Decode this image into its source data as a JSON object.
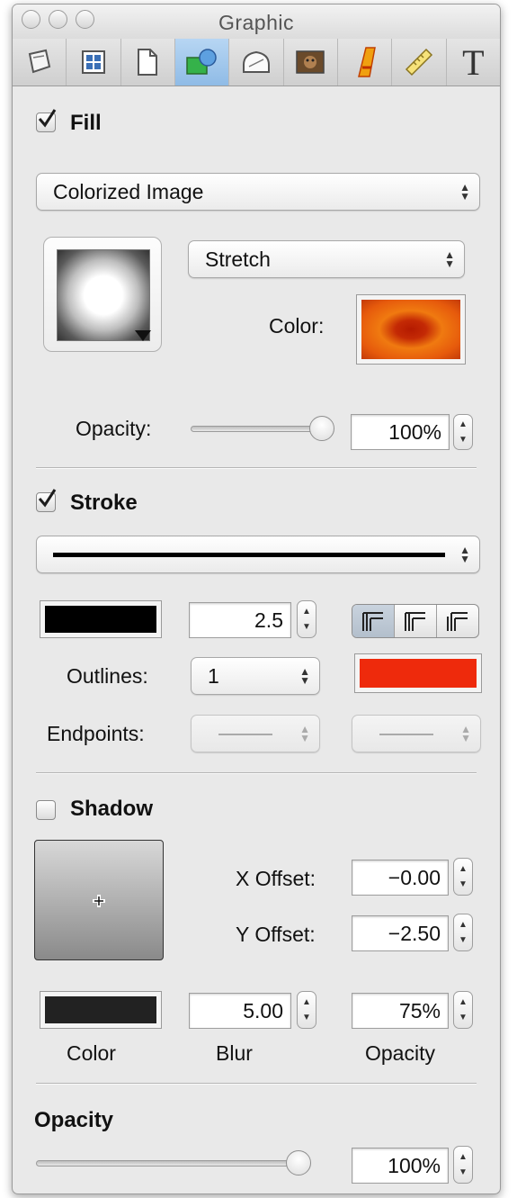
{
  "window": {
    "title": "Graphic"
  },
  "toolbar": {
    "tabs": [
      {
        "icon": "pen-tool-icon"
      },
      {
        "icon": "grid-icon"
      },
      {
        "icon": "document-icon"
      },
      {
        "icon": "shape-icon",
        "active": true
      },
      {
        "icon": "shape-outline-icon"
      },
      {
        "icon": "image-icon"
      },
      {
        "icon": "font-style-icon"
      },
      {
        "icon": "ruler-icon"
      },
      {
        "icon": "text-icon",
        "glyph": "T"
      }
    ]
  },
  "fill": {
    "checkbox_label": "Fill",
    "checked": true,
    "type_select": "Colorized Image",
    "scale_select": "Stretch",
    "color_label": "Color:",
    "opacity_label": "Opacity:",
    "opacity_value": "100%",
    "opacity_level": 1.0
  },
  "stroke": {
    "checkbox_label": "Stroke",
    "checked": true,
    "color": "#000000",
    "width_value": "2.5",
    "outlines_label": "Outlines:",
    "outlines_value": "1",
    "outline_color": "#ee2a0c",
    "endpoints_label": "Endpoints:"
  },
  "shadow": {
    "checkbox_label": "Shadow",
    "checked": false,
    "x_offset_label": "X Offset:",
    "x_offset_value": "−0.00",
    "y_offset_label": "Y Offset:",
    "y_offset_value": "−2.50",
    "blur_value": "5.00",
    "opacity_value": "75%",
    "color_caption": "Color",
    "blur_caption": "Blur",
    "opacity_caption": "Opacity",
    "color": "#222222"
  },
  "object_opacity": {
    "label": "Opacity",
    "value": "100%",
    "level": 0.97
  },
  "colors": {
    "fill_color": "#e0570a",
    "active_tab": "#9cc4ea"
  }
}
